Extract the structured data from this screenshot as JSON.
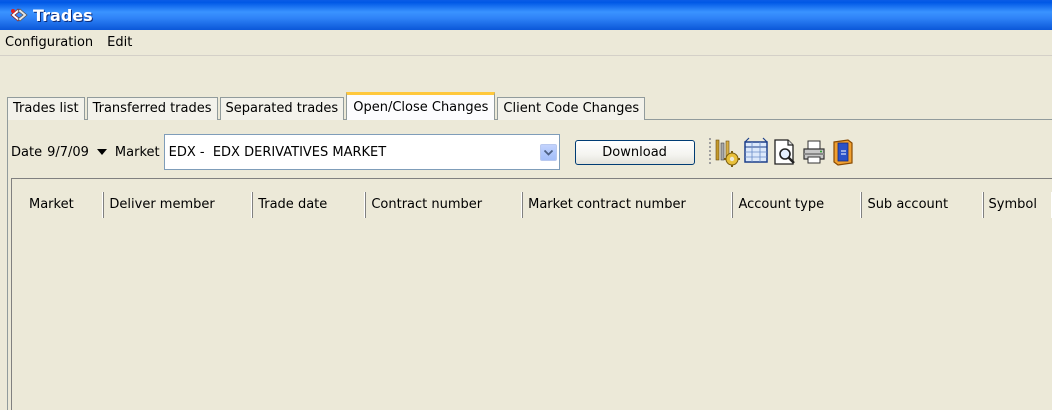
{
  "window": {
    "title": "Trades",
    "title_icon": "trades-app-icon"
  },
  "menu": {
    "items": [
      {
        "label": "Configuration"
      },
      {
        "label": "Edit"
      }
    ]
  },
  "tabs": [
    {
      "label": "Trades list",
      "active": false
    },
    {
      "label": "Transferred trades",
      "active": false
    },
    {
      "label": "Separated trades",
      "active": false
    },
    {
      "label": "Open/Close Changes",
      "active": true
    },
    {
      "label": "Client Code Changes",
      "active": false
    }
  ],
  "toolbar": {
    "date_label": "Date",
    "date_value": "9/7/09",
    "market_label": "Market",
    "market_value": "EDX -  EDX DERIVATIVES MARKET",
    "download_label": "Download",
    "icons": [
      "settings-tools-icon",
      "column-layout-icon",
      "print-preview-icon",
      "print-icon",
      "export-icon"
    ]
  },
  "grid": {
    "columns": [
      "Market",
      "Deliver member",
      "Trade date",
      "Contract number",
      "Market contract number",
      "Account type",
      "Sub account",
      "Symbol"
    ],
    "rows": []
  },
  "colors": {
    "titlebar": "#0a5ce6",
    "window_bg": "#ece9d8",
    "active_tab_accent": "#ffc83c"
  }
}
